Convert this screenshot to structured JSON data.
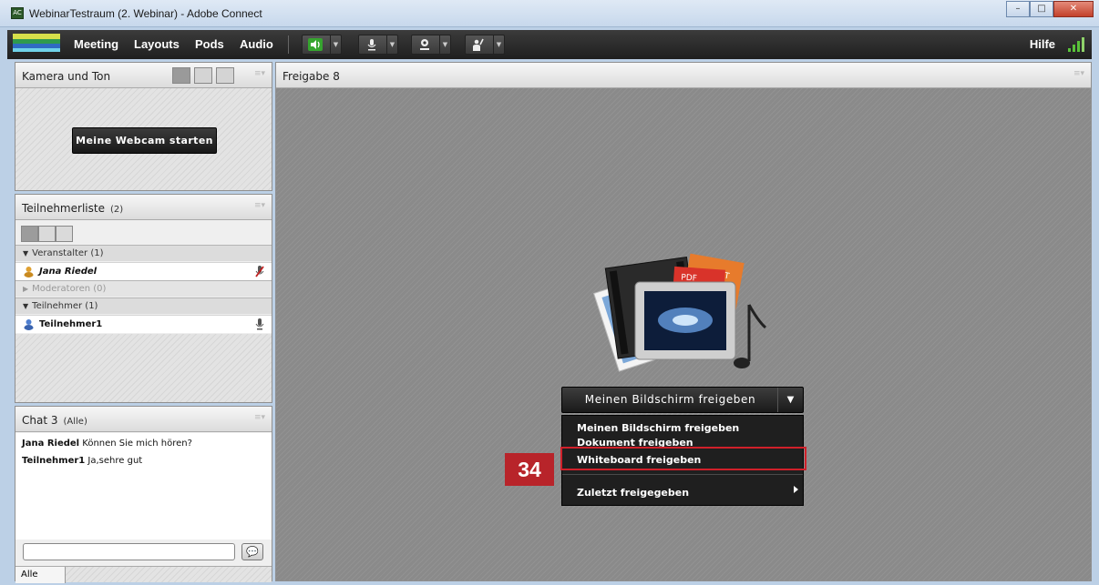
{
  "window": {
    "title": "WebinarTestraum (2. Webinar) - Adobe Connect",
    "app_icon": "adobe-connect-icon",
    "controls": [
      "minimize",
      "maximize",
      "close"
    ]
  },
  "menubar": {
    "items": [
      "Meeting",
      "Layouts",
      "Pods",
      "Audio"
    ],
    "tools": [
      "speaker-icon",
      "microphone-icon",
      "webcam-icon",
      "raise-hand-icon"
    ],
    "help": "Hilfe",
    "signal_icon": "connection-strength-icon"
  },
  "camera_pod": {
    "title": "Kamera und Ton",
    "start_button": "Meine Webcam starten"
  },
  "attendees_pod": {
    "title": "Teilnehmerliste",
    "count": "(2)",
    "sections": [
      {
        "label": "Veranstalter (1)",
        "expanded": true
      },
      {
        "label": "Moderatoren (0)",
        "expanded": false
      },
      {
        "label": "Teilnehmer (1)",
        "expanded": true
      }
    ],
    "hosts": [
      {
        "name": "Jana Riedel"
      }
    ],
    "participants": [
      {
        "name": "Teilnehmer1"
      }
    ]
  },
  "chat_pod": {
    "title": "Chat 3",
    "scope": "(Alle)",
    "messages": [
      {
        "sender": "Jana Riedel",
        "text": " Können Sie mich hören?"
      },
      {
        "sender": "Teilnehmer1",
        "text": "  Ja,sehre gut"
      }
    ],
    "footer_tab": "Alle",
    "send_icon": "speech-bubble-icon"
  },
  "share_pod": {
    "title": "Freigabe 8",
    "share_button": "Meinen Bildschirm freigeben",
    "menu": [
      "Meinen Bildschirm freigeben",
      "Dokument freigeben",
      "Whiteboard freigeben",
      "Zuletzt freigegeben"
    ],
    "doc_labels": [
      "PPT",
      "PDF"
    ]
  },
  "annotation": {
    "step_number": "34",
    "highlight_color": "#d0202a"
  }
}
